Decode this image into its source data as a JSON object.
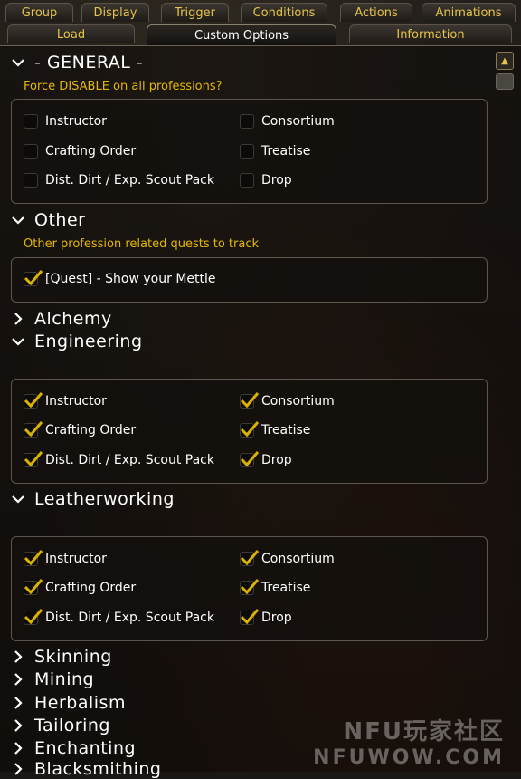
{
  "tabs": {
    "row1": [
      "Group",
      "Display",
      "Trigger",
      "Conditions",
      "Actions",
      "Animations"
    ],
    "row2": [
      "Load",
      "Custom Options",
      "Information"
    ],
    "active": "Custom Options"
  },
  "sections": {
    "general": {
      "title": "- GENERAL -",
      "expanded": true,
      "subtitle": "Force DISABLE on all professions?",
      "options": [
        {
          "label": "Instructor",
          "checked": false
        },
        {
          "label": "Consortium",
          "checked": false
        },
        {
          "label": "Crafting Order",
          "checked": false
        },
        {
          "label": "Treatise",
          "checked": false
        },
        {
          "label": "Dist. Dirt / Exp. Scout Pack",
          "checked": false
        },
        {
          "label": "Drop",
          "checked": false
        }
      ]
    },
    "other": {
      "title": "Other",
      "expanded": true,
      "subtitle": "Other profession related quests to track",
      "options": [
        {
          "label": "[Quest] - Show your Mettle",
          "checked": true
        }
      ]
    },
    "alchemy": {
      "title": "Alchemy",
      "expanded": false
    },
    "engineering": {
      "title": "Engineering",
      "expanded": true,
      "options": [
        {
          "label": "Instructor",
          "checked": true
        },
        {
          "label": "Consortium",
          "checked": true
        },
        {
          "label": "Crafting Order",
          "checked": true
        },
        {
          "label": "Treatise",
          "checked": true
        },
        {
          "label": "Dist. Dirt / Exp. Scout Pack",
          "checked": true
        },
        {
          "label": "Drop",
          "checked": true
        }
      ]
    },
    "leatherworking": {
      "title": "Leatherworking",
      "expanded": true,
      "options": [
        {
          "label": "Instructor",
          "checked": true
        },
        {
          "label": "Consortium",
          "checked": true
        },
        {
          "label": "Crafting Order",
          "checked": true
        },
        {
          "label": "Treatise",
          "checked": true
        },
        {
          "label": "Dist. Dirt / Exp. Scout Pack",
          "checked": true
        },
        {
          "label": "Drop",
          "checked": true
        }
      ]
    },
    "collapsed": [
      "Skinning",
      "Mining",
      "Herbalism",
      "Tailoring",
      "Enchanting",
      "Blacksmithing"
    ]
  },
  "watermark": {
    "top": "NFU玩家社区",
    "bottom": "NFUWOW.COM"
  },
  "colors": {
    "accent": "#e6b800",
    "check": "#d9b300",
    "text": "#ffffff"
  }
}
